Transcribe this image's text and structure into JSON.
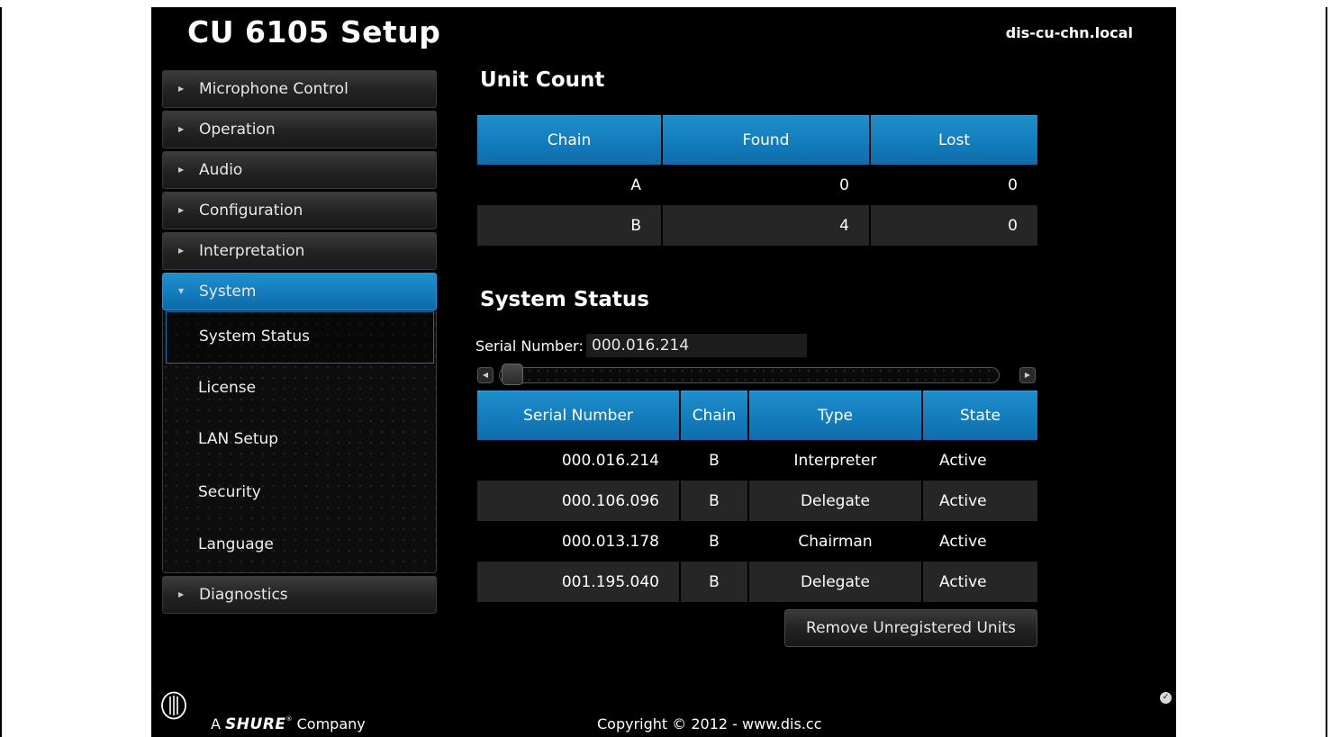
{
  "app": {
    "title": "CU 6105 Setup",
    "hostname": "dis-cu-chn.local"
  },
  "sidebar": {
    "items": [
      {
        "label": "Microphone Control"
      },
      {
        "label": "Operation"
      },
      {
        "label": "Audio"
      },
      {
        "label": "Configuration"
      },
      {
        "label": "Interpretation"
      },
      {
        "label": "System",
        "expanded": true
      },
      {
        "label": "Diagnostics"
      }
    ],
    "system_sub": [
      {
        "label": "System Status",
        "selected": true
      },
      {
        "label": "License"
      },
      {
        "label": "LAN Setup"
      },
      {
        "label": "Security"
      },
      {
        "label": "Language"
      }
    ]
  },
  "unit_count": {
    "title": "Unit Count",
    "headers": [
      "Chain",
      "Found",
      "Lost"
    ],
    "rows": [
      [
        "A",
        "0",
        "0"
      ],
      [
        "B",
        "4",
        "0"
      ]
    ]
  },
  "system_status": {
    "title": "System Status",
    "serial_label": "Serial Number:",
    "serial_value": "000.016.214",
    "scroll_position": 0,
    "headers": [
      "Serial Number",
      "Chain",
      "Type",
      "State"
    ],
    "rows": [
      [
        "000.016.214",
        "B",
        "Interpreter",
        "Active"
      ],
      [
        "000.106.096",
        "B",
        "Delegate",
        "Active"
      ],
      [
        "000.013.178",
        "B",
        "Chairman",
        "Active"
      ],
      [
        "001.195.040",
        "B",
        "Delegate",
        "Active"
      ]
    ],
    "remove_button": "Remove Unregistered Units"
  },
  "footer": {
    "company_prefix": "A",
    "company_brand": "SHURE",
    "company_suffix": "Company",
    "copyright": "Copyright © 2012 - www.dis.cc"
  },
  "colors": {
    "accent": "#137cbd",
    "background": "#000000"
  }
}
